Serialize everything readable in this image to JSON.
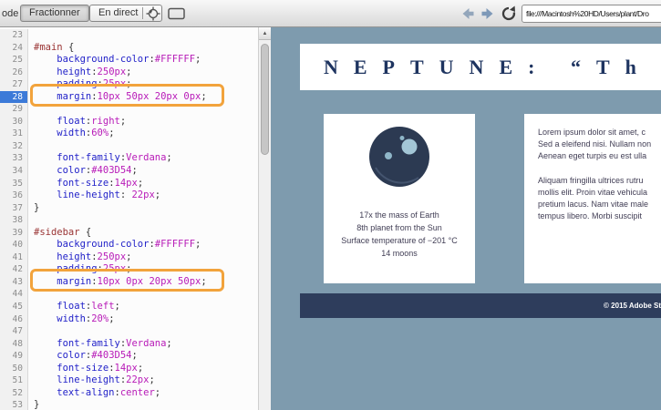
{
  "colors": {
    "accent": "#F2A33C",
    "page-bg": "#7E9BAE",
    "footer-navy": "#2E3D5C",
    "title-navy": "#1E3460",
    "body-text": "#403D54",
    "planet-navy": "#2C3A52",
    "moon-blue": "#A3C6D6",
    "active-line-blue": "#3C7AD8",
    "code-selector": "#993333",
    "code-property": "#1F1FC8",
    "code-value": "#B81BB8"
  },
  "toolbar": {
    "code_label": "ode",
    "split_label": "Fractionner",
    "live_label": "En direct",
    "dropdown_arrow": "▼",
    "url": "file:///Macintosh%20HD/Users/plant/Dro"
  },
  "scrollbar": {
    "up_arrow": "▲"
  },
  "editor": {
    "active_line": "28",
    "lines": [
      {
        "n": "23",
        "code": ""
      },
      {
        "n": "24",
        "code": "#main {"
      },
      {
        "n": "25",
        "code": "    background-color:#FFFFFF;"
      },
      {
        "n": "26",
        "code": "    height:250px;"
      },
      {
        "n": "27",
        "code": "    padding:25px;"
      },
      {
        "n": "28",
        "code": "    margin:10px 50px 20px 0px;"
      },
      {
        "n": "29",
        "code": ""
      },
      {
        "n": "30",
        "code": "    float:right;"
      },
      {
        "n": "31",
        "code": "    width:60%;"
      },
      {
        "n": "32",
        "code": ""
      },
      {
        "n": "33",
        "code": "    font-family:Verdana;"
      },
      {
        "n": "34",
        "code": "    color:#403D54;"
      },
      {
        "n": "35",
        "code": "    font-size:14px;"
      },
      {
        "n": "36",
        "code": "    line-height: 22px;"
      },
      {
        "n": "37",
        "code": "}"
      },
      {
        "n": "38",
        "code": ""
      },
      {
        "n": "39",
        "code": "#sidebar {"
      },
      {
        "n": "40",
        "code": "    background-color:#FFFFFF;"
      },
      {
        "n": "41",
        "code": "    height:250px;"
      },
      {
        "n": "42",
        "code": "    padding:25px;"
      },
      {
        "n": "43",
        "code": "    margin:10px 0px 20px 50px;"
      },
      {
        "n": "44",
        "code": ""
      },
      {
        "n": "45",
        "code": "    float:left;"
      },
      {
        "n": "46",
        "code": "    width:20%;"
      },
      {
        "n": "47",
        "code": ""
      },
      {
        "n": "48",
        "code": "    font-family:Verdana;"
      },
      {
        "n": "49",
        "code": "    color:#403D54;"
      },
      {
        "n": "50",
        "code": "    font-size:14px;"
      },
      {
        "n": "51",
        "code": "    line-height:22px;"
      },
      {
        "n": "52",
        "code": "    text-align:center;"
      },
      {
        "n": "53",
        "code": "}"
      }
    ]
  },
  "preview": {
    "title": "NEPTUNE: “Th",
    "sidebar_facts": [
      "17x the mass of Earth",
      "8th planet from the Sun",
      "Surface temperature of −201 °C",
      "14 moons"
    ],
    "paragraph1": [
      "Lorem ipsum dolor sit amet, c",
      "Sed a eleifend nisi. Nullam non",
      "Aenean eget turpis eu est ulla"
    ],
    "paragraph2": [
      "Aliquam fringilla ultrices rutru",
      "mollis elit. Proin vitae vehicula",
      "pretium lacus. Nam vitae male",
      "tempus libero. Morbi suscipit"
    ],
    "footer_text": "© 2015 Adobe St"
  }
}
